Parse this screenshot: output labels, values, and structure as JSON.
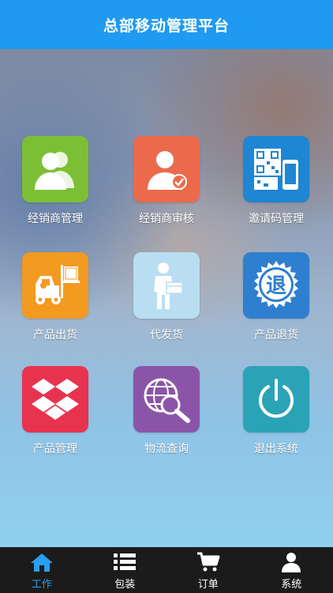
{
  "header": {
    "title": "总部移动管理平台"
  },
  "tiles": [
    {
      "label": "经销商管理",
      "color": "#7cbf35",
      "icon": "users-icon"
    },
    {
      "label": "经销商审核",
      "color": "#ec6a4c",
      "icon": "user-approve-icon"
    },
    {
      "label": "邀请码管理",
      "color": "#1e86d2",
      "icon": "qrcode-phone-icon"
    },
    {
      "label": "产品出货",
      "color": "#f39a21",
      "icon": "forklift-icon"
    },
    {
      "label": "代发货",
      "color": "#b9def2",
      "icon": "delivery-man-icon"
    },
    {
      "label": "产品退货",
      "color": "#2e7fcf",
      "icon": "return-seal-icon"
    },
    {
      "label": "产品管理",
      "color": "#e8334f",
      "icon": "dropbox-icon"
    },
    {
      "label": "物流查询",
      "color": "#8a55a8",
      "icon": "globe-search-icon"
    },
    {
      "label": "退出系统",
      "color": "#2ba3b6",
      "icon": "power-icon"
    }
  ],
  "return_seal_char": "退",
  "tabbar": {
    "items": [
      {
        "label": "工作",
        "icon": "home-icon",
        "active": true
      },
      {
        "label": "包装",
        "icon": "list-icon",
        "active": false
      },
      {
        "label": "订单",
        "icon": "cart-icon",
        "active": false
      },
      {
        "label": "系统",
        "icon": "user-icon",
        "active": false
      }
    ],
    "active_color": "#2a9ef0"
  }
}
